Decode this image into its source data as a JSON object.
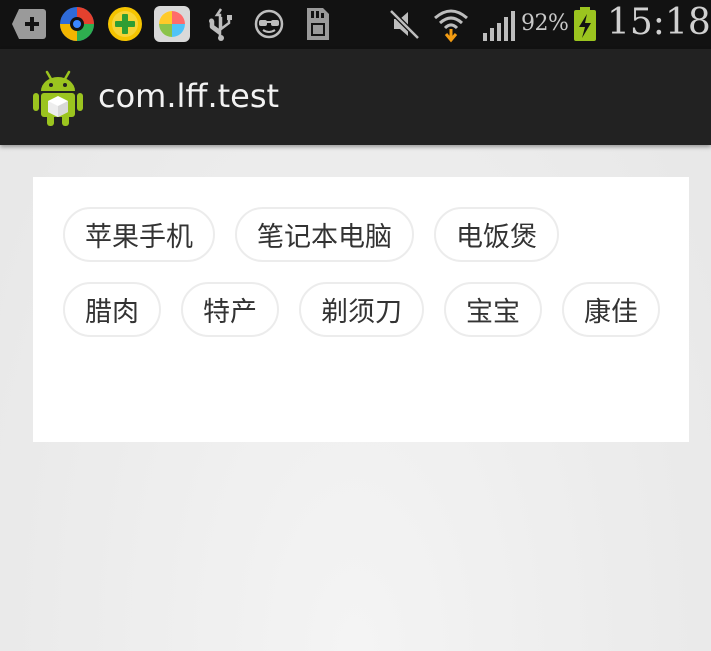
{
  "status_bar": {
    "left_icons": [
      "add-notification-icon",
      "browser-app-icon",
      "game-app-icon",
      "color-app-icon",
      "usb-icon",
      "sunglasses-icon",
      "sd-card-icon"
    ],
    "right_icons": [
      "mute-icon",
      "wifi-icon",
      "signal-icon",
      "battery-charging-icon"
    ],
    "battery_percent": "92%",
    "time": "15:18"
  },
  "action_bar": {
    "app_icon": "android-icon",
    "title": "com.lff.test"
  },
  "tags": [
    "苹果手机",
    "笔记本电脑",
    "电饭煲",
    "腊肉",
    "特产",
    "剃须刀",
    "宝宝",
    "康佳"
  ],
  "colors": {
    "status_bar_bg": "#121212",
    "action_bar_bg": "#222222",
    "page_bg": "#eaeaea",
    "card_bg": "#ffffff",
    "tag_border": "#ececec",
    "tag_text": "#333333",
    "android_green": "#9bc41f"
  }
}
